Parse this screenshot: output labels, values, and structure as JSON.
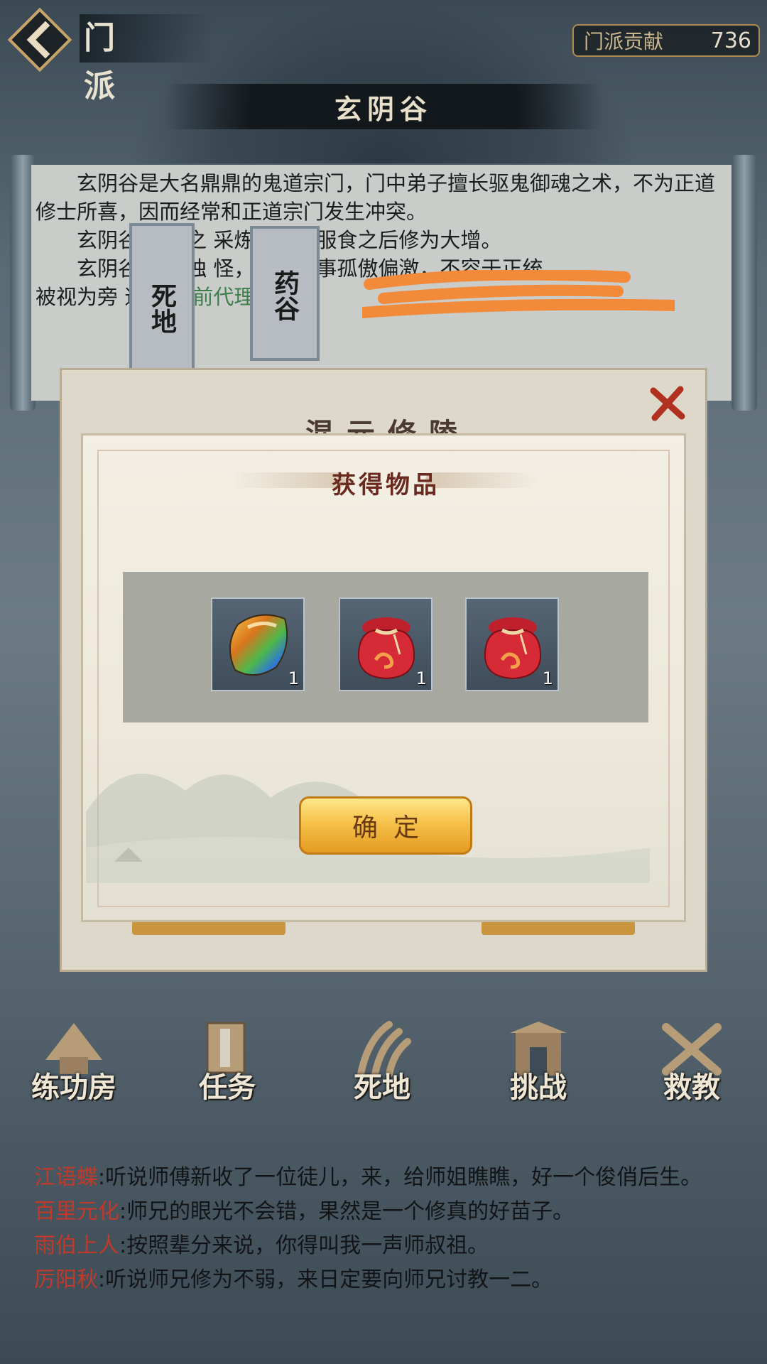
{
  "header": {
    "title": "门 派",
    "contribution_label": "门派贡献",
    "contribution_value": "736"
  },
  "sect": {
    "name": "玄阴谷",
    "description": [
      "玄阴谷是大名鼎鼎的鬼道宗门，门中弟子擅长驱鬼御魂之术，不为正道修士所喜，因而经常和正道宗门发生冲突。",
      "玄阴谷              炼丹之        采炼药草，服食之后修为大增。",
      "玄阴谷        方式独        怪，门人行事孤傲偏激，不容于正统，"
    ],
    "line4_prefix": "被视为旁     道。",
    "line4_green": "门        前代理掌门"
  },
  "tags": {
    "death_land": "死地",
    "herb_valley": "药谷"
  },
  "panel": {
    "title": "混元修陵"
  },
  "reward_dialog": {
    "title": "获得物品",
    "items": [
      {
        "icon": "rainbow-gem-icon",
        "count": "1"
      },
      {
        "icon": "red-pouch-icon",
        "count": "1"
      },
      {
        "icon": "red-pouch-icon",
        "count": "1"
      }
    ],
    "confirm_label": "确定"
  },
  "nav": [
    {
      "label": "练功房",
      "icon": "pagoda-icon"
    },
    {
      "label": "任务",
      "icon": "scroll-book-icon"
    },
    {
      "label": "死地",
      "icon": "claw-icon"
    },
    {
      "label": "挑战",
      "icon": "gate-icon"
    },
    {
      "label": "救教",
      "icon": "crossed-swords-icon"
    }
  ],
  "chat": [
    {
      "name": "江语蝶",
      "text": ":听说师傅新收了一位徒儿，来，给师姐瞧瞧，好一个俊俏后生。"
    },
    {
      "name": "百里元化",
      "text": ":师兄的眼光不会错，果然是一个修真的好苗子。"
    },
    {
      "name": "雨伯上人",
      "text": ":按照辈分来说，你得叫我一声师叔祖。"
    },
    {
      "name": "厉阳秋",
      "text": ":听说师兄修为不弱，来日定要向师兄讨教一二。"
    }
  ],
  "colors": {
    "accent_gold": "#e59b22",
    "chat_name": "#c0392b",
    "green_text": "#3d7f4b"
  }
}
